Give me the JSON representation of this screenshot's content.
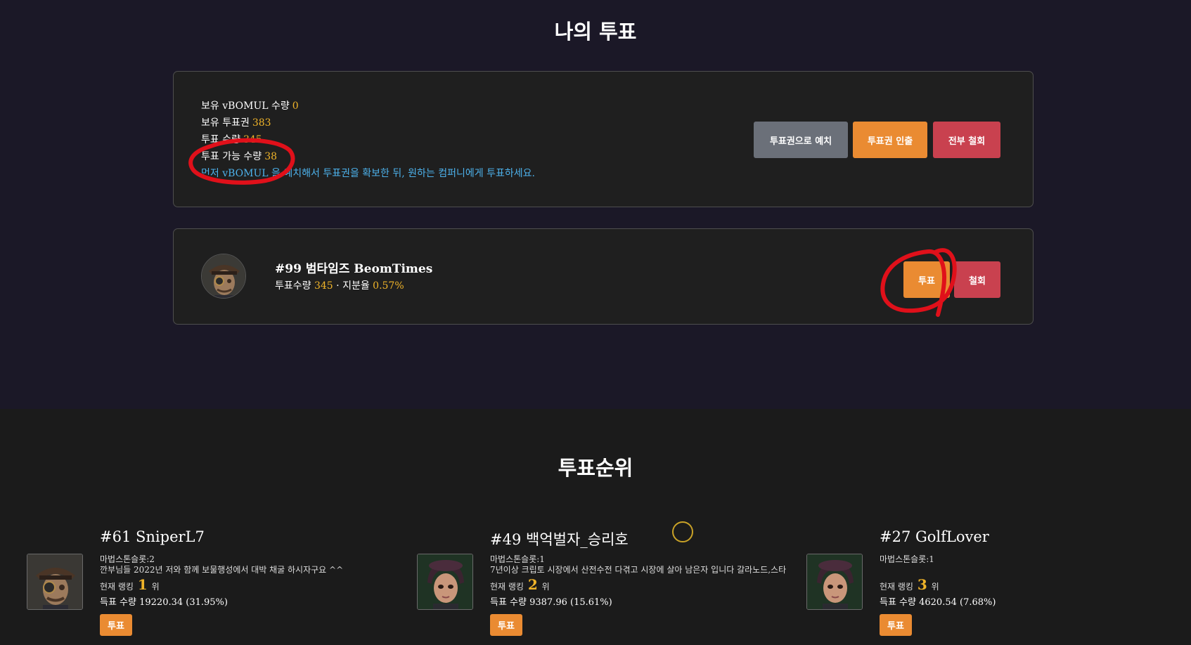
{
  "my_vote": {
    "title": "나의 투표",
    "stats": [
      {
        "label": "보유 vBOMUL 수량",
        "value": "0"
      },
      {
        "label": "보유 투표권",
        "value": "383"
      },
      {
        "label": "투표 수량",
        "value": "345"
      },
      {
        "label": "투표 가능 수량",
        "value": "38"
      }
    ],
    "info": "먼저 vBOMUL 을 예치해서 투표권을 확보한 뒤, 원하는 컴퍼니에게 투표하세요.",
    "buttons": {
      "deposit": "투표권으로 예치",
      "withdraw": "투표권 인출",
      "revoke_all": "전부 철회"
    }
  },
  "voted_company": {
    "name": "#99 범타임즈 BeomTimes",
    "votes_label": "투표수량",
    "votes": "345",
    "separator": "·",
    "share_label": "지분율",
    "share": "0.57%",
    "vote_button": "투표",
    "revoke_button": "철회"
  },
  "ranking": {
    "title": "투표순위",
    "items": [
      {
        "name": "#61 SniperL7",
        "slot": "마법스톤슬롯:2",
        "description": "깐부님들 2022년 저와 함께 보물행성에서 대박 채굴 하시자구요 ^^",
        "rank_prefix": "현재 랭킹",
        "rank": "1",
        "rank_suffix": "위",
        "votes_text": "득표 수량 19220.34 (31.95%)",
        "vote_button": "투표"
      },
      {
        "name": "#49 백억벌자_승리호",
        "slot": "마법스톤슬롯:1",
        "description": "7년이상 크립토 시장에서 산전수전 다겪고 시장에 살아 남은자 입니다 갈라노드,스타",
        "rank_prefix": "현재 랭킹",
        "rank": "2",
        "rank_suffix": "위",
        "votes_text": "득표 수량 9387.96 (15.61%)",
        "vote_button": "투표"
      },
      {
        "name": "#27 GolfLover",
        "slot": "마법스톤슬롯:1",
        "description": "",
        "rank_prefix": "현재 랭킹",
        "rank": "3",
        "rank_suffix": "위",
        "votes_text": "득표 수량 4620.54 (7.68%)",
        "vote_button": "투표"
      }
    ]
  },
  "colors": {
    "accent_orange": "#ea8b32",
    "danger_red": "#c9414f",
    "neutral_gray": "#6b7079",
    "value_yellow": "#f0b429",
    "info_blue": "#4db2ec",
    "annotation_red": "#e0101a"
  }
}
